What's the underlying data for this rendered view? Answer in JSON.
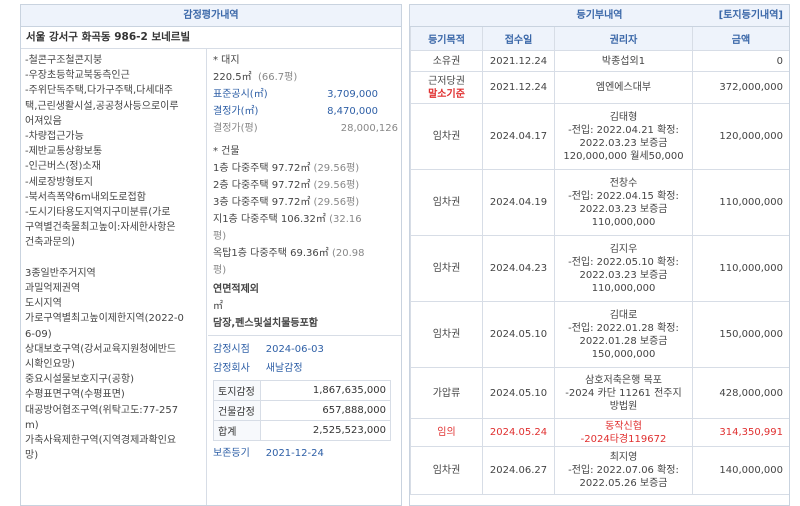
{
  "left": {
    "title": "감정평가내역",
    "address": "서울 강서구 화곡동 986-2 보네르빌",
    "notes": [
      "-철콘구조철콘지붕",
      "-우장초등학교북동측인근",
      "-주위단독주택,다가구주택,다세대주",
      "택,근린생활시설,공공청사등으로이루",
      "어져있음",
      "-차량접근가능",
      "-제반교통상황보통",
      "-인근버스(정)소재",
      "-세로장방형토지",
      "-북서측폭약6m내외도로접함",
      "-도시기타용도지역지구미분류(가로",
      "구역별건축물최고높이:자세한사항은",
      "건축과문의)",
      "",
      "3종일반주거지역",
      "과밀억제권역",
      "도시지역",
      "가로구역별최고높이제한지역(2022-0",
      "6-09)",
      "상대보호구역(강서교육지원청에반드",
      "시확인요망)",
      "중요시설물보호지구(공항)",
      "수평표면구역(수평표면)",
      "대공방어협조구역(위탁고도:77-257",
      "m)",
      "가축사육제한구역(지역경제과확인요",
      "망)"
    ],
    "land": {
      "header": "* 대지",
      "area": "220.5㎡",
      "area_pyeong": "(66.7평)",
      "public_label": "표준공시(㎡)",
      "public_value": "3,709,000",
      "decided_label": "결정가(㎡)",
      "decided_value": "8,470,000",
      "decided_py_label": "결정가(평)",
      "decided_py_value": "28,000,126"
    },
    "building": {
      "header": "* 건물",
      "floors": [
        {
          "text": "1층 다중주택 97.72㎡",
          "py": "(29.56평)"
        },
        {
          "text": "2층 다중주택 97.72㎡",
          "py": "(29.56평)"
        },
        {
          "text": "3층 다중주택 97.72㎡",
          "py": "(29.56평)"
        },
        {
          "text": "지1층 다중주택 106.32㎡",
          "py": "(32.16"
        },
        {
          "text": "",
          "py": "평)"
        },
        {
          "text": "옥탑1층 다중주택 69.36㎡",
          "py": "(20.98"
        },
        {
          "text": "",
          "py": "평)"
        }
      ],
      "excluded_label": "연면적제외",
      "excluded_unit": "㎡",
      "fixtures_label": "담장,펜스및설치물등포함"
    },
    "appraisal": {
      "date_label": "감정시점",
      "date_value": "2024-06-03",
      "company_label": "감정회사",
      "company_value": "새날감정",
      "rows": [
        {
          "label": "토지감정",
          "value": "1,867,635,000"
        },
        {
          "label": "건물감정",
          "value": "657,888,000"
        },
        {
          "label": "합계",
          "value": "2,525,523,000"
        }
      ],
      "reg_label": "보존등기",
      "reg_value": "2021-12-24"
    }
  },
  "right": {
    "title": "등기부내역",
    "link": "[토지등기내역]",
    "headers": [
      "등기목적",
      "접수일",
      "권리자",
      "금액"
    ],
    "rows": [
      {
        "purpose": [
          "소유권"
        ],
        "date": "2021.12.24",
        "holder": [
          "박종섭외1"
        ],
        "amount": "0",
        "red": false
      },
      {
        "purpose": [
          "근저당권",
          "말소기준"
        ],
        "date": "2021.12.24",
        "holder": [
          "엠엔에스대부"
        ],
        "amount": "372,000,000",
        "red": false
      },
      {
        "purpose": [
          "임차권"
        ],
        "date": "2024.04.17",
        "holder": [
          "김태형",
          "-전입: 2022.04.21 확정:",
          "2022.03.23 보증금",
          "120,000,000 월세50,000"
        ],
        "amount": "120,000,000",
        "red": false
      },
      {
        "purpose": [
          "임차권"
        ],
        "date": "2024.04.19",
        "holder": [
          "전창수",
          "-전입: 2022.04.15 확정:",
          "2022.03.23 보증금",
          "110,000,000"
        ],
        "amount": "110,000,000",
        "red": false
      },
      {
        "purpose": [
          "임차권"
        ],
        "date": "2024.04.23",
        "holder": [
          "김지우",
          "-전입: 2022.05.10 확정:",
          "2022.03.23 보증금",
          "110,000,000"
        ],
        "amount": "110,000,000",
        "red": false
      },
      {
        "purpose": [
          "임차권"
        ],
        "date": "2024.05.10",
        "holder": [
          "김대로",
          "-전입: 2022.01.28 확정:",
          "2022.01.28 보증금",
          "150,000,000"
        ],
        "amount": "150,000,000",
        "red": false
      },
      {
        "purpose": [
          "가압류"
        ],
        "date": "2024.05.10",
        "holder": [
          "삼호저축은행 목포",
          "-2024 카단 11261 전주지",
          "방법원"
        ],
        "amount": "428,000,000",
        "red": false
      },
      {
        "purpose": [
          "임의"
        ],
        "date": "2024.05.24",
        "holder": [
          "동작신협",
          "-2024타경119672"
        ],
        "amount": "314,350,991",
        "red": true
      },
      {
        "purpose": [
          "임차권"
        ],
        "date": "2024.06.27",
        "holder": [
          "최지영",
          "-전입: 2022.07.06 확정:",
          "2022.05.26 보증금"
        ],
        "amount": "140,000,000",
        "red": false
      }
    ]
  }
}
